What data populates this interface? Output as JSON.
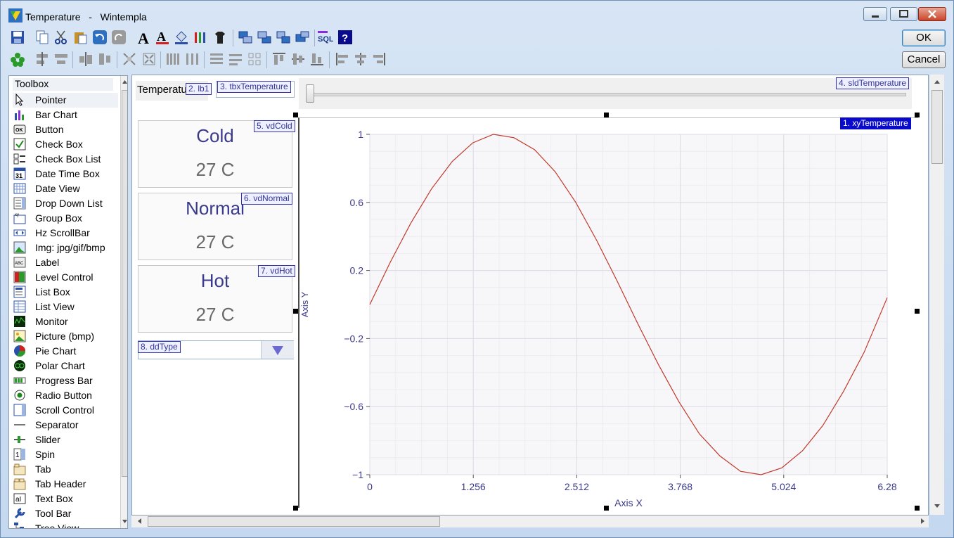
{
  "window": {
    "title": "Temperature",
    "separator": "-",
    "app_name": "Wintempla",
    "controls": {
      "minimize": "minimize",
      "maximize": "maximize",
      "close": "close"
    }
  },
  "dialog_buttons": {
    "ok": "OK",
    "cancel": "Cancel"
  },
  "toolbar_row1": [
    "save-icon",
    "copy-icon",
    "cut-icon",
    "paste-icon",
    "undo-icon",
    "redo-icon",
    "font-icon",
    "font-color-icon",
    "fill-icon",
    "pencils-icon",
    "tshirt-icon",
    "bring-forward-icon",
    "send-backward-icon",
    "swap-icon",
    "arrange-icon",
    "sql-icon",
    "help-icon"
  ],
  "toolbar_row2": [
    "tab-order-icon",
    "align-left-icon",
    "align-center-icon",
    "align-right-icon",
    "align-middle-icon",
    "expand-icon",
    "shrink-icon",
    "space-horizontal-icon",
    "space-even-icon",
    "same-width-icon",
    "same-height-icon",
    "same-size-icon",
    "align-top-icon",
    "align-vcenter-icon",
    "align-bottom-icon",
    "left-edge-icon",
    "hcenter-icon",
    "right-edge-icon"
  ],
  "toolbox": {
    "header": "Toolbox",
    "items": [
      {
        "label": "Pointer",
        "icon": "pointer-icon"
      },
      {
        "label": "Bar Chart",
        "icon": "bar-chart-icon"
      },
      {
        "label": "Button",
        "icon": "button-icon"
      },
      {
        "label": "Check Box",
        "icon": "check-box-icon"
      },
      {
        "label": "Check Box List",
        "icon": "check-box-list-icon"
      },
      {
        "label": "Date Time Box",
        "icon": "date-time-box-icon"
      },
      {
        "label": "Date View",
        "icon": "date-view-icon"
      },
      {
        "label": "Drop Down List",
        "icon": "drop-down-list-icon"
      },
      {
        "label": "Group Box",
        "icon": "group-box-icon"
      },
      {
        "label": "Hz ScrollBar",
        "icon": "hz-scrollbar-icon"
      },
      {
        "label": "Img: jpg/gif/bmp",
        "icon": "image-icon"
      },
      {
        "label": "Label",
        "icon": "label-icon"
      },
      {
        "label": "Level Control",
        "icon": "level-control-icon"
      },
      {
        "label": "List Box",
        "icon": "list-box-icon"
      },
      {
        "label": "List View",
        "icon": "list-view-icon"
      },
      {
        "label": "Monitor",
        "icon": "monitor-icon"
      },
      {
        "label": "Picture (bmp)",
        "icon": "picture-icon"
      },
      {
        "label": "Pie Chart",
        "icon": "pie-chart-icon"
      },
      {
        "label": "Polar Chart",
        "icon": "polar-chart-icon"
      },
      {
        "label": "Progress Bar",
        "icon": "progress-bar-icon"
      },
      {
        "label": "Radio Button",
        "icon": "radio-button-icon"
      },
      {
        "label": "Scroll Control",
        "icon": "scroll-control-icon"
      },
      {
        "label": "Separator",
        "icon": "separator-icon"
      },
      {
        "label": "Slider",
        "icon": "slider-icon"
      },
      {
        "label": "Spin",
        "icon": "spin-icon"
      },
      {
        "label": "Tab",
        "icon": "tab-icon"
      },
      {
        "label": "Tab Header",
        "icon": "tab-header-icon"
      },
      {
        "label": "Text Box",
        "icon": "text-box-icon"
      },
      {
        "label": "Tool Bar",
        "icon": "tool-bar-icon"
      },
      {
        "label": "Tree View",
        "icon": "tree-view-icon"
      }
    ]
  },
  "design": {
    "label_text": "Temperatu",
    "tags": {
      "lb1": "2. lb1",
      "tbx": "3. tbxTemperature",
      "sld": "4. sldTemperature",
      "xy": "1. xyTemperature",
      "vdCold": "5. vdCold",
      "vdNormal": "6. vdNormal",
      "vdHot": "7. vdHot",
      "ddType": "8. ddType"
    },
    "value_displays": [
      {
        "title": "Cold",
        "value": "27 C"
      },
      {
        "title": "Normal",
        "value": "27 C"
      },
      {
        "title": "Hot",
        "value": "27 C"
      }
    ],
    "slider_value": 0
  },
  "colors": {
    "accent": "#0a0acb",
    "curve": "#c0392b",
    "axis_text": "#3a3a8c"
  },
  "chart_data": {
    "type": "line",
    "title": "",
    "xlabel": "Axis X",
    "ylabel": "Axis Y",
    "xlim": [
      0,
      6.28
    ],
    "ylim": [
      -1,
      1
    ],
    "x_ticks": [
      0,
      1.256,
      2.512,
      3.768,
      5.024,
      6.28
    ],
    "x_tick_labels": [
      "0",
      "1.256",
      "2.512",
      "3.768",
      "5.024",
      "6.28"
    ],
    "y_ticks": [
      1,
      0.6,
      0.2,
      -0.2,
      -0.6,
      -1
    ],
    "y_tick_labels": [
      "1",
      "0.6",
      "0.2",
      "−0.2",
      "−0.6",
      "−1"
    ],
    "grid": true,
    "series": [
      {
        "x": [
          0,
          0.25,
          0.5,
          0.75,
          1.0,
          1.25,
          1.5,
          1.75,
          2.0,
          2.25,
          2.5,
          2.75,
          3.0,
          3.25,
          3.5,
          3.75,
          4.0,
          4.25,
          4.5,
          4.75,
          5.0,
          5.25,
          5.5,
          5.75,
          6.0,
          6.28
        ],
        "values": [
          0,
          0.25,
          0.48,
          0.68,
          0.84,
          0.95,
          1.0,
          0.98,
          0.91,
          0.78,
          0.6,
          0.38,
          0.14,
          -0.11,
          -0.35,
          -0.57,
          -0.76,
          -0.89,
          -0.98,
          -1.0,
          -0.96,
          -0.86,
          -0.71,
          -0.51,
          -0.28,
          0.04
        ]
      }
    ]
  }
}
